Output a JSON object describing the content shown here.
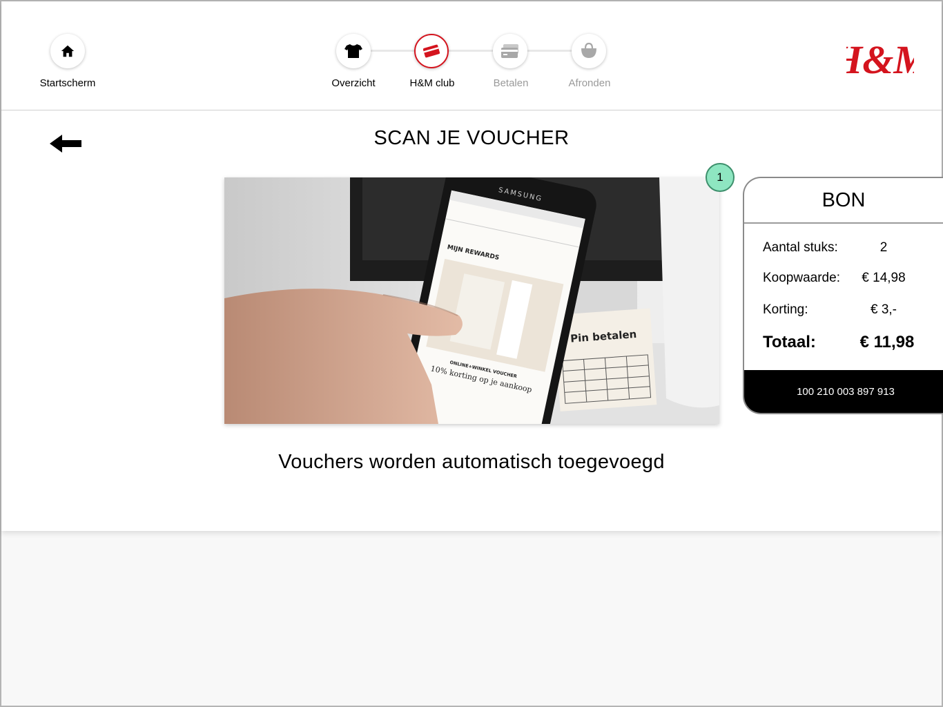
{
  "nav": {
    "home": {
      "label": "Startscherm",
      "icon": "home-icon"
    },
    "steps": [
      {
        "label": "Overzicht",
        "icon": "tshirt-icon",
        "state": "done"
      },
      {
        "label": "H&M club",
        "icon": "club-card-icon",
        "state": "active"
      },
      {
        "label": "Betalen",
        "icon": "credit-card-icon",
        "state": "upcoming"
      },
      {
        "label": "Afronden",
        "icon": "shopping-bag-icon",
        "state": "upcoming"
      }
    ],
    "logo_text": "H&M"
  },
  "colors": {
    "brand_red": "#d4141e",
    "badge_green": "#8ee6c1",
    "dim_text": "#9a9a9a"
  },
  "main": {
    "title": "SCAN JE VOUCHER",
    "caption": "Vouchers worden automatisch toegevoegd",
    "badge": "1",
    "photo": {
      "phone_brand": "SAMSUNG",
      "app_heading": "MIJN REWARDS",
      "voucher_type": "ONLINE+WINKEL VOUCHER",
      "voucher_text": "10% korting op je aankoop",
      "terminal_label": "Pin betalen"
    }
  },
  "bon": {
    "title": "BON",
    "rows": [
      {
        "label": "Aantal stuks:",
        "value": "2"
      },
      {
        "label": "Koopwaarde:",
        "value": "€ 14,98"
      },
      {
        "label": "Korting:",
        "value": "€ 3,-"
      }
    ],
    "total": {
      "label": "Totaal:",
      "value": "€ 11,98"
    },
    "barcode_number": "100 210 003 897 913"
  }
}
